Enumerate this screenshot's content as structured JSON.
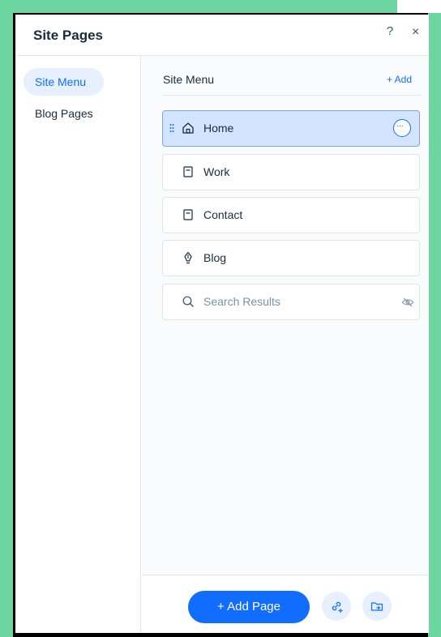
{
  "header": {
    "title": "Site Pages",
    "help_label": "?",
    "close_label": "×"
  },
  "sidebar": {
    "items": [
      {
        "label": "Site Menu"
      },
      {
        "label": "Blog Pages"
      }
    ]
  },
  "main": {
    "section_title": "Site Menu",
    "add_label": "+ Add",
    "pages": [
      {
        "label": "Home",
        "icon": "home-icon"
      },
      {
        "label": "Work",
        "icon": "page-icon"
      },
      {
        "label": "Contact",
        "icon": "page-icon"
      },
      {
        "label": "Blog",
        "icon": "blog-pen-icon"
      },
      {
        "label": "Search Results",
        "icon": "search-icon"
      }
    ],
    "more_label": "···"
  },
  "footer": {
    "add_page_label": "+ Add Page"
  },
  "colors": {
    "accent": "#116dff",
    "selected_bg": "#d4e3ff",
    "frame_green": "#6dd5a0"
  }
}
